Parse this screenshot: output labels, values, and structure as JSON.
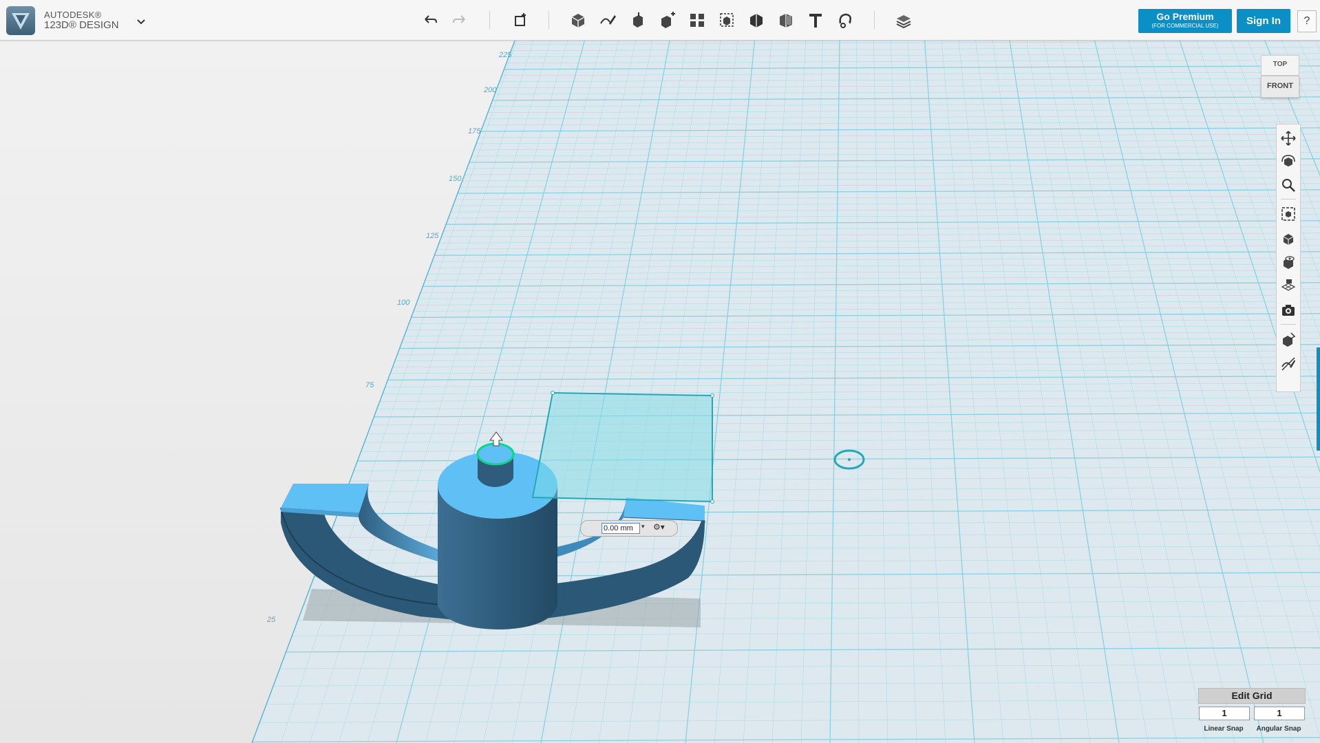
{
  "app": {
    "brand_line1": "AUTODESK®",
    "brand_line2": "123D® DESIGN",
    "menu_icon": "chevron-down-icon"
  },
  "toolbar": {
    "tools": [
      "undo-icon",
      "redo-icon",
      "transform-icon",
      "primitives-icon",
      "sketch-icon",
      "construct-icon",
      "modify-icon",
      "pattern-icon",
      "grouping-icon",
      "combine-icon",
      "measure-icon",
      "text-icon",
      "snap-icon",
      "material-icon"
    ]
  },
  "header": {
    "premium_label": "Go Premium",
    "premium_sub": "(FOR COMMERCIAL USE)",
    "signin_label": "Sign In",
    "help_label": "?"
  },
  "viewcube": {
    "top_label": "TOP",
    "front_label": "FRONT"
  },
  "nav_tools": [
    "pan-icon",
    "orbit-icon",
    "zoom-icon",
    "fit-icon",
    "view-icon",
    "visibility-icon",
    "grid-icon",
    "snapshot-icon",
    "material-icon",
    "sketch-visibility-icon"
  ],
  "grid": {
    "ruler_labels": [
      "225",
      "200",
      "175",
      "150",
      "125",
      "100",
      "75",
      "25"
    ]
  },
  "value_input": {
    "value": "0.00 mm"
  },
  "edit_grid": {
    "title": "Edit Grid",
    "linear_snap_value": "1",
    "angular_snap_value": "1",
    "linear_snap_label": "Linear Snap",
    "angular_snap_label": "Angular Snap"
  },
  "colors": {
    "accent": "#0a8fc7",
    "grid_line": "#7fcfe3",
    "model_top": "#5ec0f5",
    "model_side": "#2c5a78"
  }
}
